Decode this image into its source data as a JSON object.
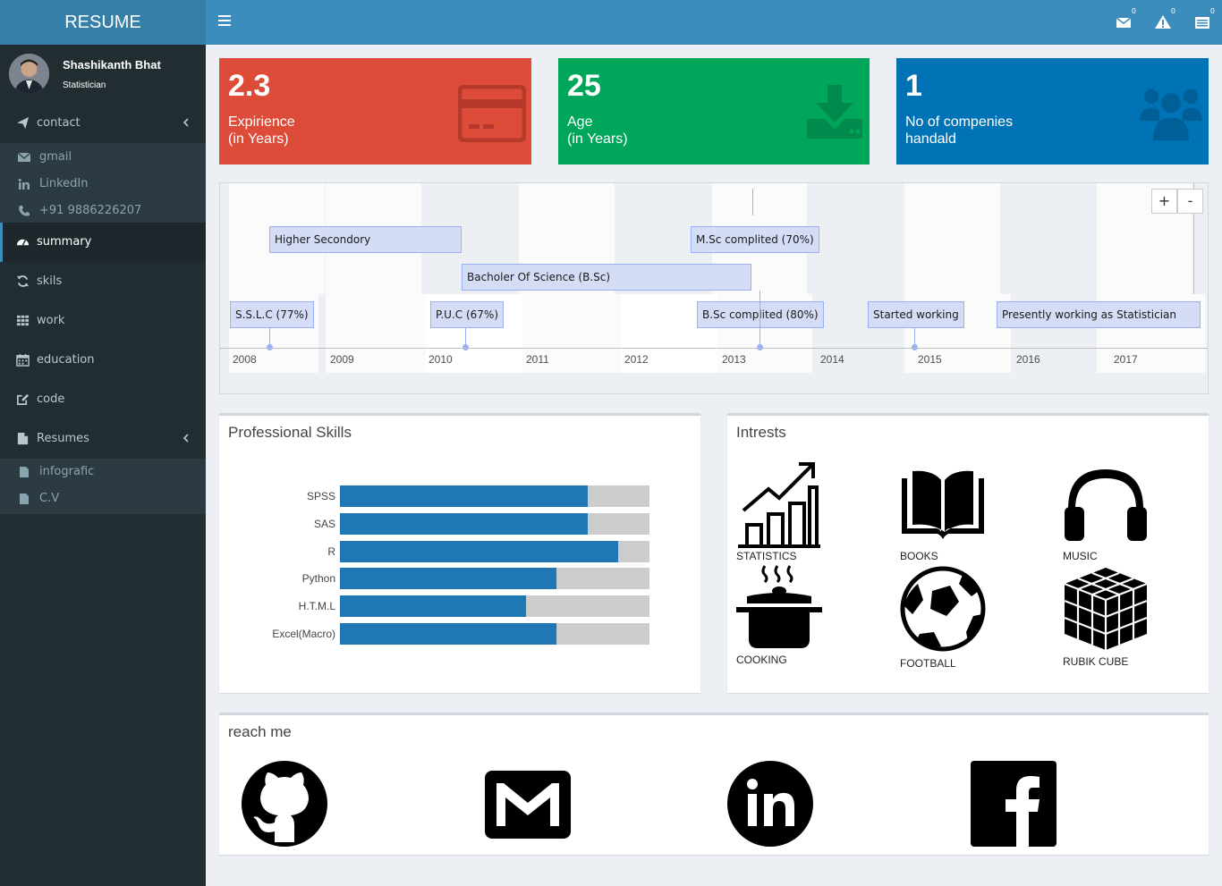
{
  "app": {
    "logo": "RESUME"
  },
  "header": {
    "mail_count": "0",
    "alert_count": "0",
    "tasks_count": "0"
  },
  "user": {
    "name": "Shashikanth Bhat",
    "role": "Statistician"
  },
  "sidebar": {
    "contact": "contact",
    "contact_items": [
      "gmail",
      "LinkedIn",
      "+91 9886226207"
    ],
    "summary": "summary",
    "skills": "skils",
    "work": "work",
    "education": "education",
    "code": "code",
    "resumes": "Resumes",
    "resume_items": [
      "infografic",
      "C.V"
    ]
  },
  "infoboxes": [
    {
      "value": "2.3",
      "line1": "Expirience",
      "line2": "(in Years)",
      "color": "#dd4b39",
      "icon": "credit-card-icon"
    },
    {
      "value": "25",
      "line1": "Age",
      "line2": "(in Years)",
      "color": "#00a65a",
      "icon": "download-icon"
    },
    {
      "value": "1",
      "line1": "No of compenies",
      "line2": "handald",
      "color": "#0073b7",
      "icon": "users-icon"
    }
  ],
  "timeline": {
    "items": [
      "Higher Secondory",
      "M.Sc complited (70%)",
      "Bacholer Of Science (B.Sc)",
      "S.S.L.C (77%)",
      "P.U.C (67%)",
      "B.Sc complited (80%)",
      "Started working",
      "Presently working as Statistician"
    ],
    "years": [
      "2008",
      "2009",
      "2010",
      "2011",
      "2012",
      "2013",
      "2014",
      "2015",
      "2016",
      "2017"
    ],
    "zoom_in": "+",
    "zoom_out": "-"
  },
  "skills_box": {
    "title": "Professional Skills"
  },
  "chart_data": {
    "type": "bar",
    "orientation": "horizontal",
    "categories": [
      "SPSS",
      "SAS",
      "R",
      "Python",
      "H.T.M.L",
      "Excel(Macro)"
    ],
    "values": [
      80,
      80,
      90,
      70,
      60,
      70
    ],
    "xlim": [
      0,
      100
    ],
    "colors": {
      "fill": "#1f77b4",
      "track": "#cccccc"
    }
  },
  "interests_box": {
    "title": "Intrests",
    "items": [
      "STATISTICS",
      "BOOKS",
      "MUSIC",
      "COOKING",
      "FOOTBALL",
      "RUBIK CUBE"
    ]
  },
  "reach_box": {
    "title": "reach me",
    "links": [
      "github-icon",
      "gmail-icon",
      "linkedin-icon",
      "facebook-icon"
    ]
  }
}
